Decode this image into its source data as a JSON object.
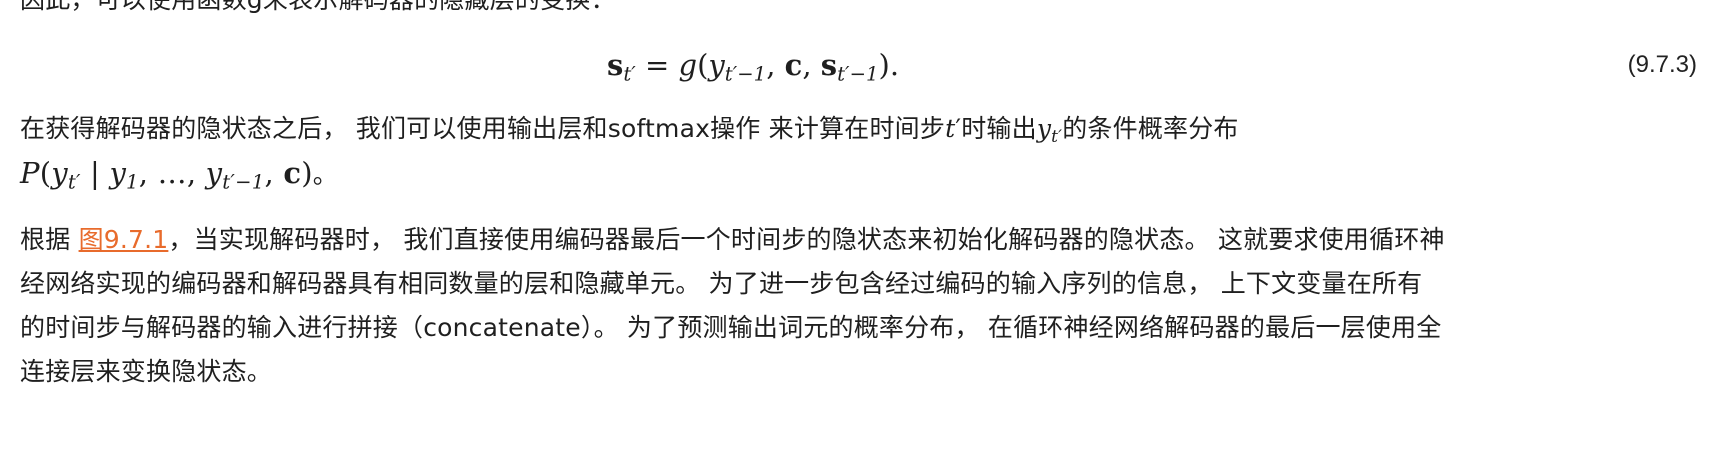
{
  "top_clipped_text": "因此，可以使用函数g来表示解码器的隐藏层的变换：",
  "equation": {
    "lhs_symbol": "s",
    "lhs_sub": "t′",
    "eq": " = ",
    "func": "g",
    "open": "(",
    "arg1": "y",
    "arg1_sub": "t′−1",
    "comma1": ", ",
    "arg2": "c",
    "comma2": ", ",
    "arg3": "s",
    "arg3_sub": "t′−1",
    "close": ").",
    "number": "(9.7.3)"
  },
  "para1": {
    "text_a": "在获得解码器的隐状态之后， 我们可以使用输出层和softmax操作 来计算在时间步",
    "math_t": "t",
    "math_t_prime": "′",
    "text_b": "时输出",
    "math_y": "y",
    "math_y_sub": "t′",
    "text_c": "的条件概率分布",
    "formula_p": "P",
    "formula_open": "(",
    "formula_y": "y",
    "formula_y_sub": "t′",
    "formula_mid": " | ",
    "formula_y1": "y",
    "formula_y1_sub": "1",
    "formula_dots": ", …, ",
    "formula_yt": "y",
    "formula_yt_sub": "t′−1",
    "formula_comma": ", ",
    "formula_c": "c",
    "formula_close": ")",
    "formula_end": "。"
  },
  "para2": {
    "lead": "根据 ",
    "ref_link": "图9.7.1",
    "line1_rest": "，当实现解码器时， 我们直接使用编码器最后一个时间步的隐状态来初始化解码器的隐状态。 这就要求使用循环神",
    "line2": "经网络实现的编码器和解码器具有相同数量的层和隐藏单元。 为了进一步包含经过编码的输入序列的信息， 上下文变量在所有",
    "line3": "的时间步与解码器的输入进行拼接（concatenate）。 为了预测输出词元的概率分布， 在循环神经网络解码器的最后一层使用全",
    "line4": "连接层来变换隐状态。"
  },
  "colors": {
    "text": "#1f1f1f",
    "link": "#e86b2c",
    "background": "#ffffff"
  }
}
